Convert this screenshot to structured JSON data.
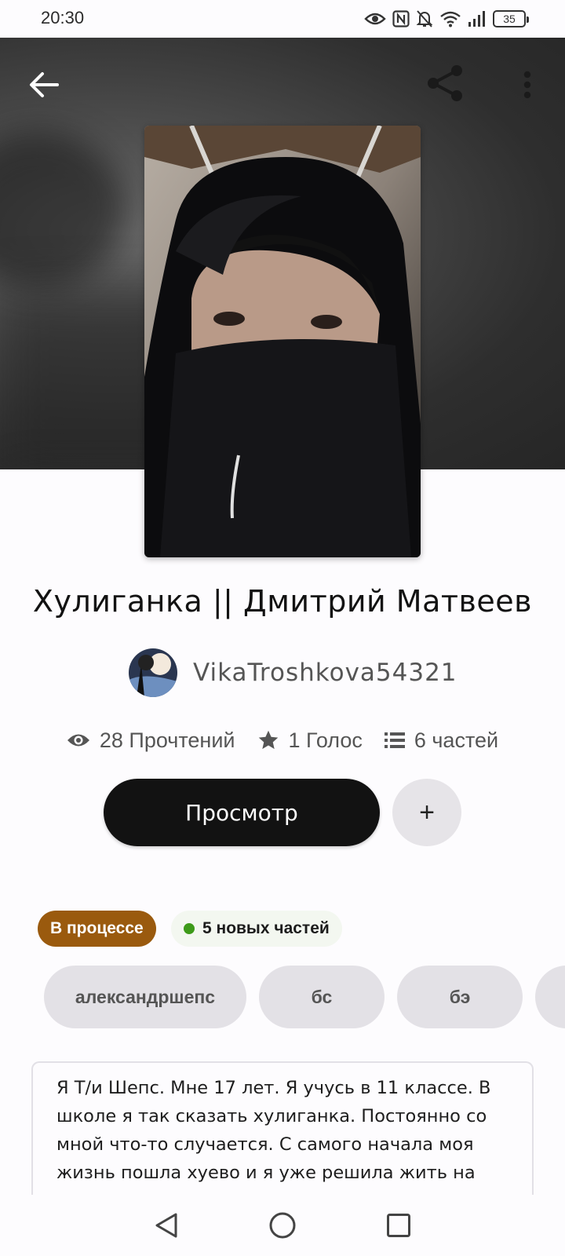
{
  "status_bar": {
    "time": "20:30",
    "battery": "35",
    "icons": [
      "eye-icon",
      "nfc-icon",
      "bell-muted-icon",
      "wifi-icon",
      "signal-icon",
      "battery-icon"
    ]
  },
  "header": {
    "back_icon": "arrow-left-icon",
    "share_icon": "share-icon",
    "more_icon": "more-vertical-icon"
  },
  "story": {
    "title": "Хулиганка || Дмитрий Матвеев",
    "author": "VikaTroshkova54321",
    "stats": {
      "reads": "28 Прочтений",
      "votes": "1 Голос",
      "parts": "6 частей"
    },
    "read_button": "Просмотр",
    "add_button": "+",
    "status": "В процессе",
    "new_parts": "5 новых частей",
    "tags": [
      "александршепс",
      "бс",
      "бэ"
    ],
    "description": "Я Т/и Шепс. Мне 17 лет. Я учусь в 11 классе. В школе я так сказать хулиганка. Постоянно со мной что-то случается. С самого начала моя жизнь пошла хуево и я уже решила жить на"
  },
  "colors": {
    "status_chip": "#9a5a0e",
    "new_parts_dot": "#3d9a19",
    "button_dark": "#121212",
    "tag_bg": "#e3e1e6"
  },
  "nav_bar": [
    "back-triangle-icon",
    "home-circle-icon",
    "recents-square-icon"
  ]
}
